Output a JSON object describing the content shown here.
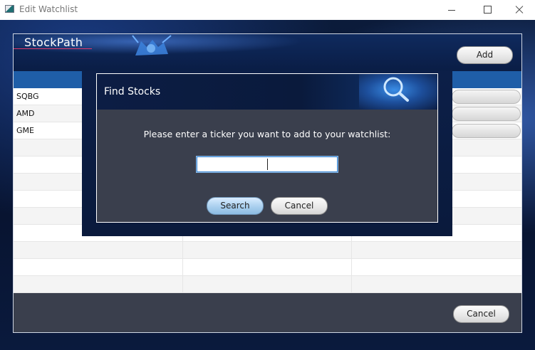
{
  "window": {
    "title": "Edit Watchlist"
  },
  "brand": {
    "name": "StockPath"
  },
  "toolbar": {
    "add_label": "Add"
  },
  "watchlist": {
    "rows": [
      {
        "ticker": "SQBG"
      },
      {
        "ticker": "AMD"
      },
      {
        "ticker": "GME"
      },
      {
        "ticker": ""
      },
      {
        "ticker": ""
      },
      {
        "ticker": ""
      },
      {
        "ticker": ""
      },
      {
        "ticker": ""
      },
      {
        "ticker": ""
      },
      {
        "ticker": ""
      },
      {
        "ticker": ""
      },
      {
        "ticker": ""
      }
    ]
  },
  "footer": {
    "cancel_label": "Cancel"
  },
  "dialog": {
    "title": "Find Stocks",
    "prompt": "Please enter a ticker you want to add to your watchlist:",
    "input_value": "",
    "search_label": "Search",
    "cancel_label": "Cancel"
  },
  "colors": {
    "panel_background": "#3a3f4d",
    "header_blue": "#1f5ea8",
    "brand_underline": "#e03a6b",
    "primary_button": "#a9cfee"
  },
  "icons": [
    "app-icon",
    "minimize-icon",
    "maximize-icon",
    "close-icon",
    "bull-logo-icon",
    "magnifier-icon"
  ]
}
